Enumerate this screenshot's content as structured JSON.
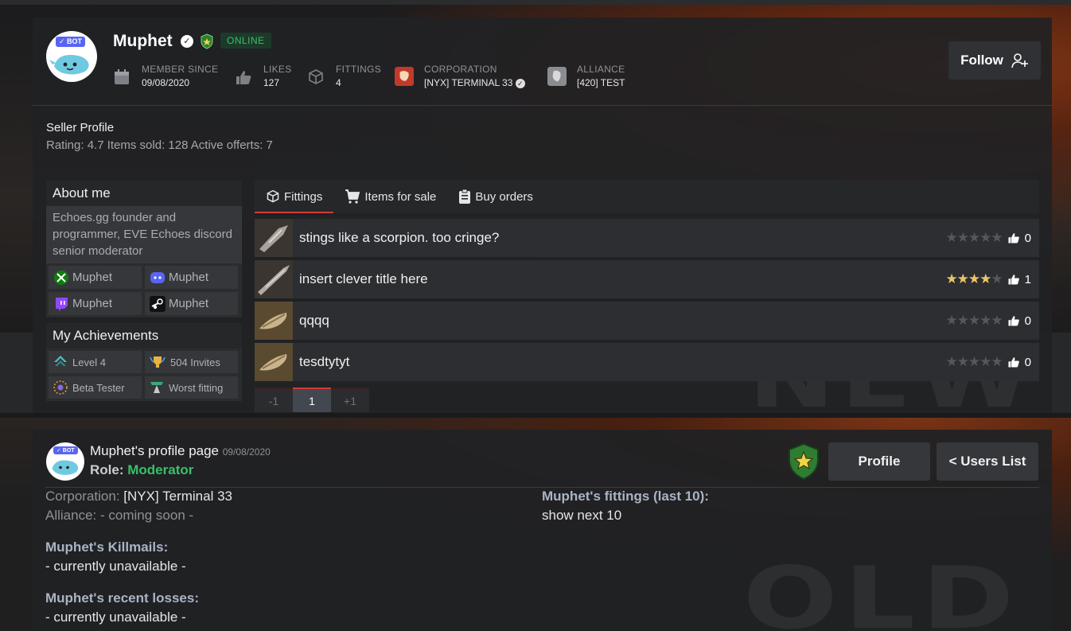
{
  "profile": {
    "username": "Muphet",
    "bot_badge": "✓ BOT",
    "status": "ONLINE",
    "follow_label": "Follow",
    "stats": [
      {
        "label": "MEMBER SINCE",
        "value": "09/08/2020",
        "icon": "calendar-icon"
      },
      {
        "label": "LIKES",
        "value": "127",
        "icon": "thumbs-up-icon"
      },
      {
        "label": "FITTINGS",
        "value": "4",
        "icon": "cube-icon"
      },
      {
        "label": "CORPORATION",
        "value": "[NYX] TERMINAL 33",
        "icon": "corporation-logo-icon"
      },
      {
        "label": "ALLIANCE",
        "value": "[420] TEST",
        "icon": "alliance-logo-icon"
      }
    ]
  },
  "seller": {
    "title": "Seller Profile",
    "stats": "Rating: 4.7  Items sold: 128  Active offerts: 7"
  },
  "about": {
    "title": "About me",
    "text": "Echoes.gg founder and programmer, EVE Echoes discord senior moderator",
    "socials": [
      {
        "name": "Muphet",
        "icon": "xbox-icon",
        "color": "#107c10"
      },
      {
        "name": "Muphet",
        "icon": "discord-icon",
        "color": "#5865f2"
      },
      {
        "name": "Muphet",
        "icon": "twitch-icon",
        "color": "#9146ff"
      },
      {
        "name": "Muphet",
        "icon": "steam-icon",
        "color": "#ffffff"
      }
    ]
  },
  "achievements": {
    "title": "My Achievements",
    "items": [
      {
        "label": "Level 4",
        "icon": "level-icon"
      },
      {
        "label": "504 Invites",
        "icon": "invites-trophy-icon"
      },
      {
        "label": "Beta Tester",
        "icon": "beta-tester-icon"
      },
      {
        "label": "Worst fitting",
        "icon": "worst-fitting-icon"
      }
    ]
  },
  "tabs": [
    {
      "label": "Fittings",
      "icon": "cube-icon",
      "active": true
    },
    {
      "label": "Items for sale",
      "icon": "cart-icon",
      "active": false
    },
    {
      "label": "Buy orders",
      "icon": "clipboard-icon",
      "active": false
    }
  ],
  "fittings": [
    {
      "name": "stings like a scorpion. too cringe?",
      "rating": 0,
      "likes": "0"
    },
    {
      "name": "insert clever title here",
      "rating": 4,
      "likes": "1"
    },
    {
      "name": "qqqq",
      "rating": 0,
      "likes": "0"
    },
    {
      "name": "tesdtytyt",
      "rating": 0,
      "likes": "0"
    }
  ],
  "pager": {
    "prev": "-1",
    "current": "1",
    "next": "+1"
  },
  "watermarks": {
    "new": "NEW",
    "old": "OLD"
  },
  "old": {
    "title": "Muphet's profile page",
    "date": "09/08/2020",
    "role_label": "Role:",
    "role_value": "Moderator",
    "profile_btn": "Profile",
    "users_list_btn": "< Users List",
    "bot_badge": "✓ BOT",
    "corp_label": "Corporation:",
    "corp_value": "[NYX] Terminal 33",
    "alliance_label": "Alliance:",
    "alliance_value": "- coming soon -",
    "killmails_title": "Muphet's Killmails:",
    "killmails_value": "- currently unavailable -",
    "losses_title": "Muphet's recent losses:",
    "losses_value": "- currently unavailable -",
    "fittings_title": "Muphet's fittings (last 10):",
    "fittings_link": "show next 10"
  }
}
